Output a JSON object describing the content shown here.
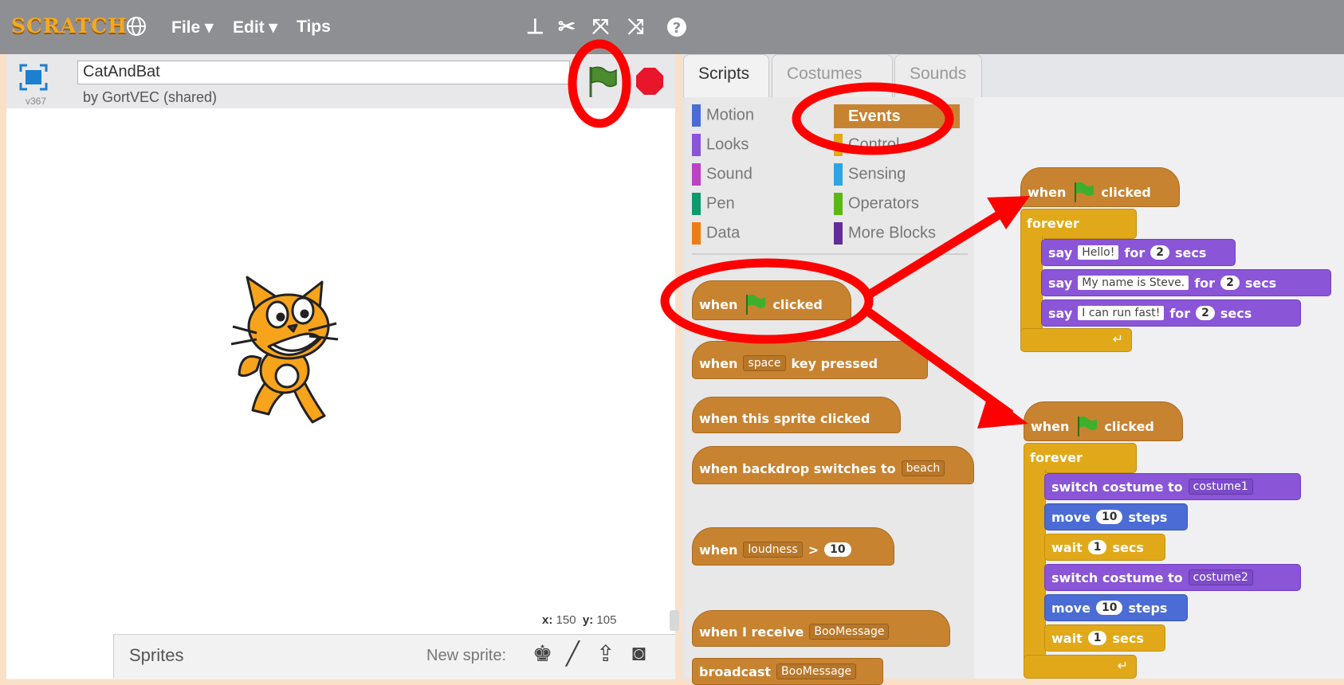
{
  "menu": {
    "logo": "SCRATCH",
    "file": "File ▾",
    "edit": "Edit ▾",
    "tips": "Tips"
  },
  "toolbar_icons": [
    "stamp-icon",
    "cut-icon",
    "grow-icon",
    "shrink-icon",
    "help-icon"
  ],
  "project": {
    "title": "CatAndBat",
    "author": "by GortVEC (shared)",
    "version": "v367"
  },
  "stage": {
    "x_label": "x:",
    "x_value": "150",
    "y_label": "y:",
    "y_value": "105"
  },
  "sprite_pane": {
    "title": "Sprites",
    "new_sprite_label": "New sprite:"
  },
  "tabs": {
    "scripts": "Scripts",
    "costumes": "Costumes",
    "sounds": "Sounds"
  },
  "categories_left": [
    {
      "label": "Motion",
      "color": "#4a6cd4"
    },
    {
      "label": "Looks",
      "color": "#8a55d7"
    },
    {
      "label": "Sound",
      "color": "#bb42c3"
    },
    {
      "label": "Pen",
      "color": "#0e9a6c"
    },
    {
      "label": "Data",
      "color": "#ee7d16"
    }
  ],
  "categories_right": [
    {
      "label": "Events",
      "color": "#c88330"
    },
    {
      "label": "Control",
      "color": "#e1a91a"
    },
    {
      "label": "Sensing",
      "color": "#2ca5e2"
    },
    {
      "label": "Operators",
      "color": "#5cb712"
    },
    {
      "label": "More Blocks",
      "color": "#632d99"
    }
  ],
  "palette": {
    "b1_when": "when",
    "b1_clicked": "clicked",
    "b2_when": "when",
    "b2_key": "space",
    "b2_rest": "key pressed",
    "b3": "when this sprite clicked",
    "b4": "when backdrop switches to",
    "b4_val": "beach",
    "b5_when": "when",
    "b5_sel": "loudness",
    "b5_op": ">",
    "b5_num": "10",
    "b6": "when I receive",
    "b6_val": "BooMessage",
    "b7": "broadcast",
    "b7_val": "BooMessage"
  },
  "script1": {
    "hat_when": "when",
    "hat_clicked": "clicked",
    "forever": "forever",
    "say": "say",
    "for": "for",
    "secs": "secs",
    "msg1": "Hello!",
    "n1": "2",
    "msg2": "My name is Steve.",
    "n2": "2",
    "msg3": "I can run fast!",
    "n3": "2",
    "end_arrow": "↵"
  },
  "script2": {
    "hat_when": "when",
    "hat_clicked": "clicked",
    "forever": "forever",
    "switch": "switch costume to",
    "c1": "costume1",
    "c2": "costume2",
    "move": "move",
    "steps": "steps",
    "m1": "10",
    "m2": "10",
    "wait": "wait",
    "secs": "secs",
    "w1": "1",
    "w2": "1",
    "end_arrow": "↵"
  },
  "colors": {
    "annotation": "#ff0000",
    "menubar": "#8e8f93",
    "events": "#c88330",
    "control": "#e1a91a",
    "looks": "#8a55d7",
    "motion": "#4a6cd4"
  }
}
